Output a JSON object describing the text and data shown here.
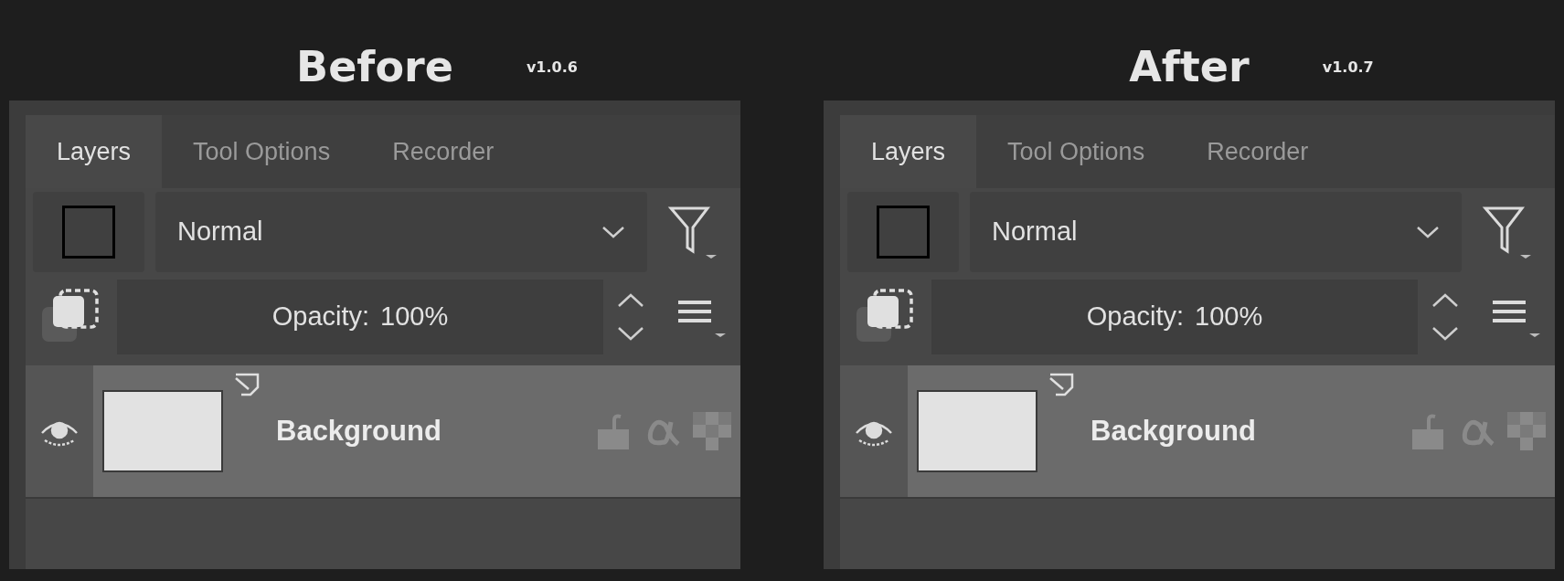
{
  "panels": [
    {
      "title": "Before",
      "version": "v1.0.6",
      "tabs": [
        {
          "label": "Layers",
          "selected": true
        },
        {
          "label": "Tool Options",
          "selected": false
        },
        {
          "label": "Recorder",
          "selected": false
        }
      ],
      "blend_mode": "Normal",
      "opacity_label": "Opacity:",
      "opacity_value": "100%",
      "layers": [
        {
          "name": "Background",
          "visible": true,
          "selected": true
        }
      ]
    },
    {
      "title": "After",
      "version": "v1.0.7",
      "tabs": [
        {
          "label": "Layers",
          "selected": true
        },
        {
          "label": "Tool Options",
          "selected": false
        },
        {
          "label": "Recorder",
          "selected": false
        }
      ],
      "blend_mode": "Normal",
      "opacity_label": "Opacity:",
      "opacity_value": "100%",
      "layers": [
        {
          "name": "Background",
          "visible": true,
          "selected": true
        }
      ]
    }
  ]
}
